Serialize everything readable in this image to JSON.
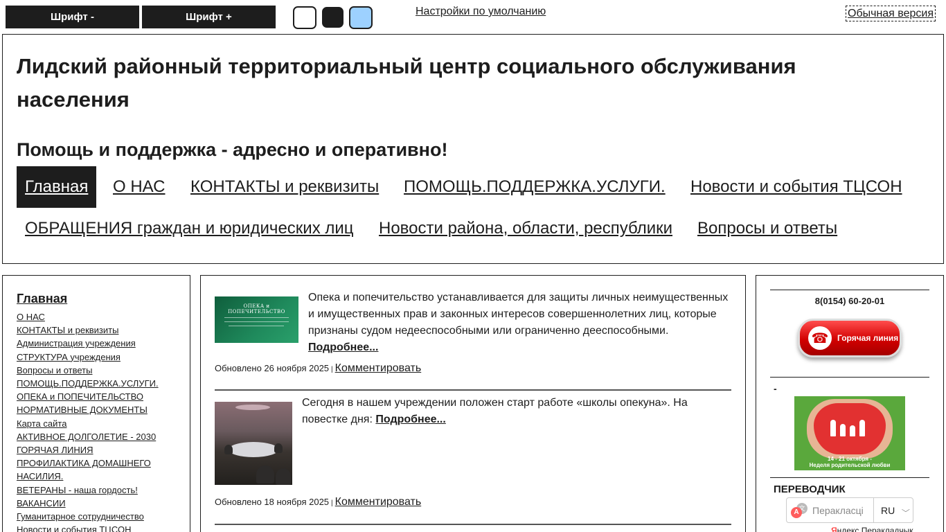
{
  "accessibility_bar": {
    "font_minus_label": "Шрифт -",
    "font_plus_label": "Шрифт +",
    "color_schemes": [
      {
        "name": "white",
        "color": "#ffffff"
      },
      {
        "name": "black",
        "color": "#1d1d1d"
      },
      {
        "name": "blue",
        "color": "#9dd1ff"
      }
    ],
    "defaults_link": "Настройки по умолчанию",
    "normal_version_link": "Обычная версия"
  },
  "header": {
    "title": "Лидский районный территориальный центр социального обслуживания населения",
    "slogan": "Помощь и поддержка - адресно и оперативно!",
    "nav": [
      {
        "label": "Главная",
        "active": true
      },
      {
        "label": "О НАС"
      },
      {
        "label": "КОНТАКТЫ и реквизиты"
      },
      {
        "label": "ПОМОЩЬ.ПОДДЕРЖКА.УСЛУГИ."
      },
      {
        "label": "Новости и события ТЦСОН"
      },
      {
        "label": "ОБРАЩЕНИЯ граждан и юридических лиц"
      },
      {
        "label": "Новости района, области, республики"
      },
      {
        "label": "Вопросы и ответы"
      }
    ]
  },
  "sidebar": {
    "heading": "Главная",
    "items": [
      "О НАС",
      "КОНТАКТЫ и реквизиты",
      "Администрация учреждения",
      "СТРУКТУРА учреждения",
      "Вопросы и ответы",
      "ПОМОЩЬ.ПОДДЕРЖКА.УСЛУГИ.",
      "ОПЕКА и ПОПЕЧИТЕЛЬСТВО",
      "НОРМАТИВНЫЕ ДОКУМЕНТЫ",
      "Карта сайта",
      "АКТИВНОЕ ДОЛГОЛЕТИЕ - 2030",
      "ГОРЯЧАЯ ЛИНИЯ",
      "ПРОФИЛАКТИКА ДОМАШНЕГО НАСИЛИЯ.",
      "ВЕТЕРАНЫ - наша гордость!",
      "ВАКАНСИИ",
      "Гуманитарное сотрудничество",
      "Новости и события ТЦСОН"
    ]
  },
  "articles": [
    {
      "thumb_title": "ОПЕКА и ПОПЕЧИТЕЛЬСТВО",
      "text": "Опека и попечительство устанавливается для защиты личных неимущественных и имущественных прав и законных интересов совершеннолетних лиц, которые признаны судом недееспособными или ограниченно дееспособными.",
      "more": "Подробнее...",
      "updated": "Обновлено 26 ноября 2025",
      "separator": "|",
      "comment": "Комментировать"
    },
    {
      "text": "Сегодня в нашем учреждении положен старт работе «школы опекуна». На повестке дня:",
      "more": "Подробнее...",
      "updated": "Обновлено 18 ноября 2025",
      "separator": "|",
      "comment": "Комментировать"
    }
  ],
  "right_sidebar": {
    "phone": "8(0154) 60-20-01",
    "hotline_label": "Горячая линия",
    "dash": "-",
    "banner_caption_dates": "14 - 21 октября -",
    "banner_caption_title": "Неделя родительской любви",
    "translator_title": "ПЕРЕВОДЧИК",
    "translate_placeholder": "Перакласці",
    "language": "RU",
    "translator_footer_prefix": "Я",
    "translator_footer_rest": "ндекс Перакладчык"
  }
}
